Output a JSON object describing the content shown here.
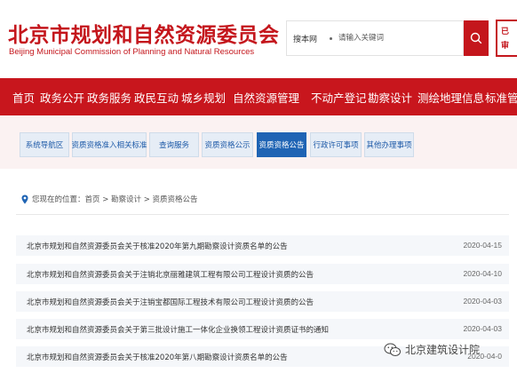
{
  "header": {
    "logo_cn": "北京市规划和自然资源委员会",
    "logo_en": "Beijing Municipal Commission of Planning and Natural Resources",
    "search_scope": "搜本网",
    "search_placeholder": "请输入关键词"
  },
  "nav": {
    "items": [
      "首页",
      "政务公开",
      "政务服务",
      "政民互动",
      "城乡规划",
      "自然资源管理",
      "不动产登记",
      "勘察设计",
      "测绘地理信息",
      "标准管理"
    ]
  },
  "subnav": {
    "tabs": [
      "系统导航区",
      "资质资格准入相关标准",
      "查询服务",
      "资质资格公示",
      "资质资格公告",
      "行政许可事项",
      "其他办理事项"
    ],
    "active_index": 4
  },
  "breadcrumb": {
    "text": "您现在的位置：首页 > 勘察设计 > 资质资格公告"
  },
  "notices": [
    {
      "title": "北京市规划和自然资源委员会关于核准2020年第九期勘察设计资质名单的公告",
      "date": "2020-04-15"
    },
    {
      "title": "北京市规划和自然资源委员会关于注销北京丽雅建筑工程有限公司工程设计资质的公告",
      "date": "2020-04-10"
    },
    {
      "title": "北京市规划和自然资源委员会关于注销宝都国际工程技术有限公司工程设计资质的公告",
      "date": "2020-04-03"
    },
    {
      "title": "北京市规划和自然资源委员会关于第三批设计施工一体化企业换领工程设计资质证书的通知",
      "date": "2020-04-03"
    },
    {
      "title": "北京市规划和自然资源委员会关于核准2020年第八期勘察设计资质名单的公告",
      "date": "2020-04-0"
    }
  ],
  "watermark": {
    "text": "北京建筑设计院"
  },
  "colors": {
    "brand_red": "#c8161d",
    "tab_active": "#1f64b4",
    "tab_text": "#1e5aa8"
  }
}
